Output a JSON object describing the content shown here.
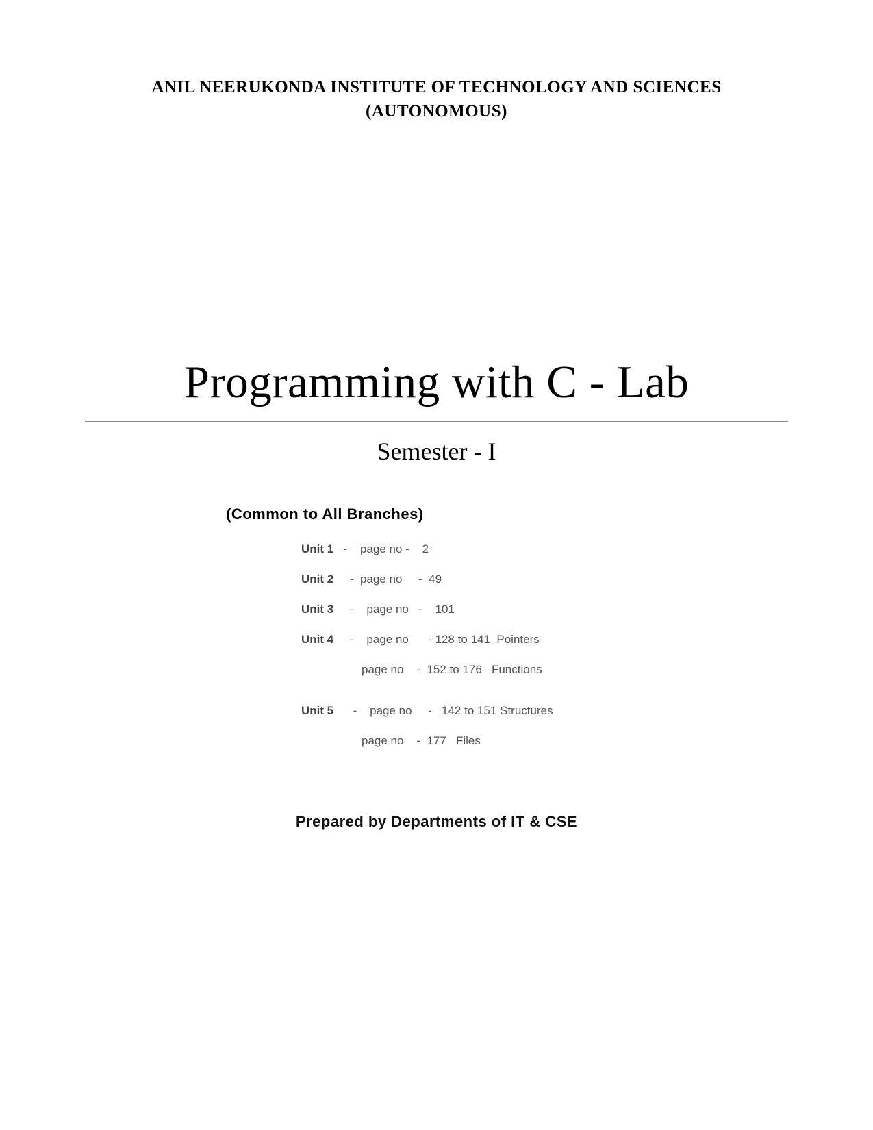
{
  "header": {
    "institute_line1": "ANIL NEERUKONDA INSTITUTE OF TECHNOLOGY AND SCIENCES",
    "institute_line2": "(AUTONOMOUS)"
  },
  "title": "Programming with C - Lab",
  "semester": "Semester - I",
  "common": "(Common to All Branches)",
  "units": {
    "u1_label": "Unit 1",
    "u1_text": "   -    page no -    2",
    "u2_label": "Unit 2",
    "u2_text": "     -  page no     -  49",
    "u3_label": "Unit 3",
    "u3_text": "     -    page no   -    101",
    "u4_label": "Unit 4",
    "u4_text": "     -    page no      - 128 to 141  Pointers",
    "u4_sub": "page no    -  152 to 176   Functions",
    "u5_label": "Unit 5",
    "u5_text": "      -    page no     -   142 to 151 Structures",
    "u5_sub": "page no    -  177   Files"
  },
  "footer": "Prepared by Departments of IT & CSE"
}
